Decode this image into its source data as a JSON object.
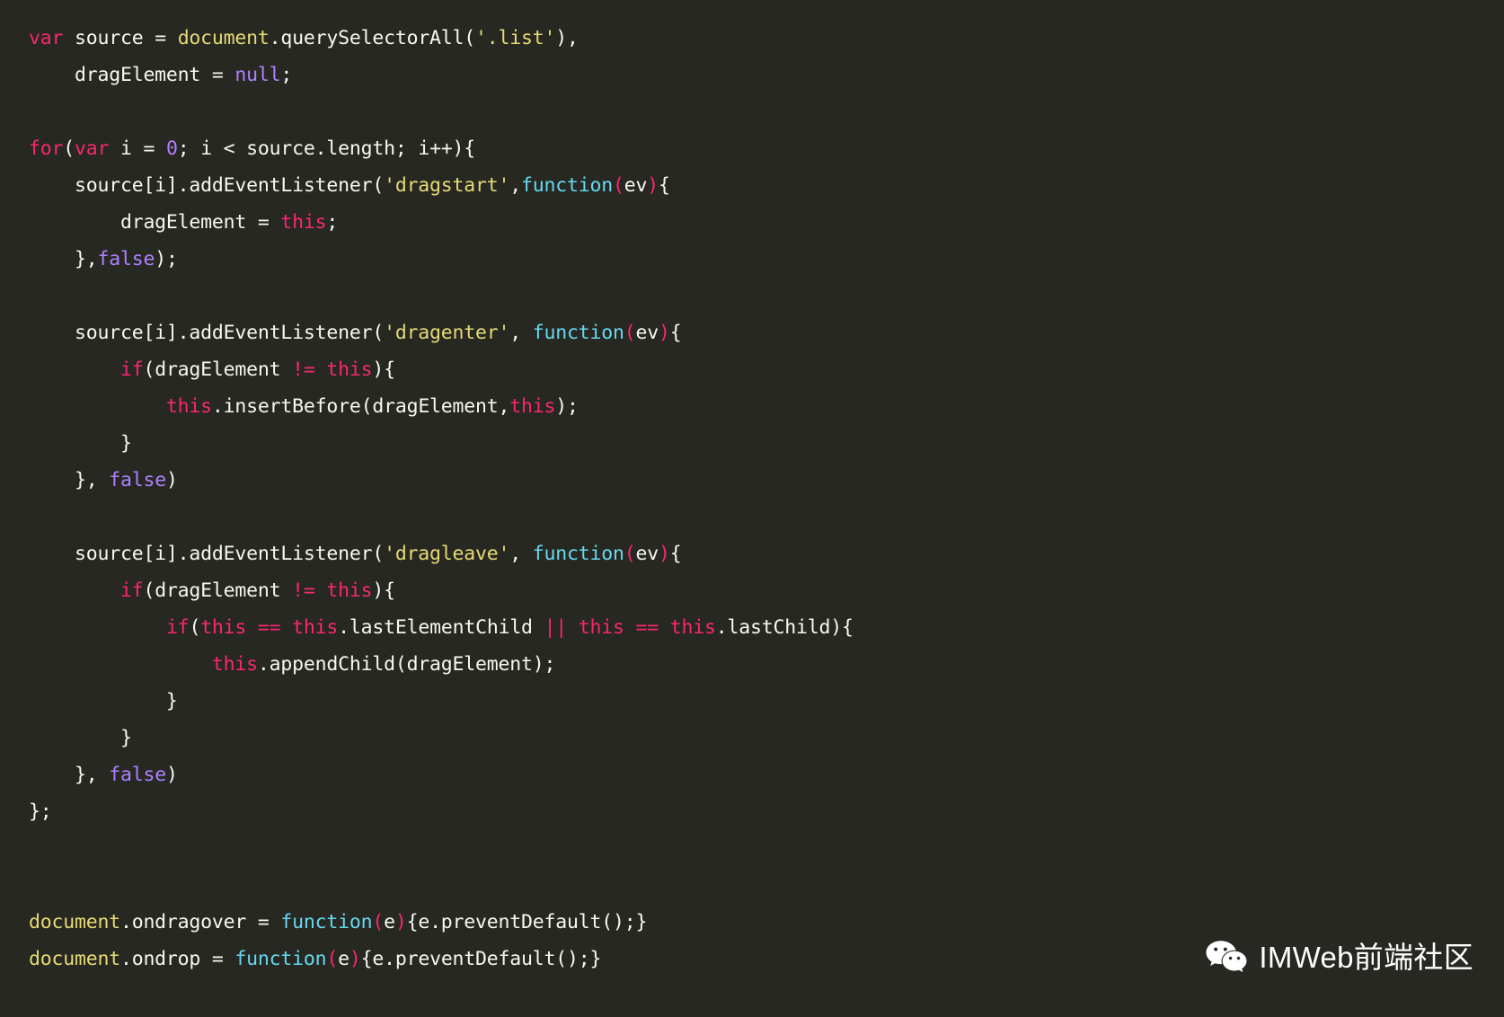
{
  "editor": {
    "theme_name": "monokai",
    "language": "javascript",
    "background_color": "#272822",
    "default_text_color": "#F8F8F2",
    "colors": {
      "keyword": "#F92672",
      "string": "#E6DB74",
      "identifier": "#E6DB74",
      "function_keyword": "#66D9EF",
      "literal": "#AE81FF",
      "punctuation": "#F92672",
      "plain": "#F8F8F2"
    },
    "lines": [
      {
        "id": "line-1",
        "tokens": [
          {
            "t": "var",
            "c": "kw"
          },
          {
            "t": " source ",
            "c": "plain"
          },
          {
            "t": "= ",
            "c": "plain"
          },
          {
            "t": "document",
            "c": "ident"
          },
          {
            "t": ".querySelectorAll(",
            "c": "plain"
          },
          {
            "t": "'.list'",
            "c": "str"
          },
          {
            "t": "),",
            "c": "plain"
          }
        ]
      },
      {
        "id": "line-2",
        "tokens": [
          {
            "t": "    dragElement = ",
            "c": "plain"
          },
          {
            "t": "null",
            "c": "lit"
          },
          {
            "t": ";",
            "c": "plain"
          }
        ]
      },
      {
        "id": "line-3",
        "tokens": [
          {
            "t": " ",
            "c": "plain"
          }
        ]
      },
      {
        "id": "line-4",
        "tokens": [
          {
            "t": "for",
            "c": "kw"
          },
          {
            "t": "(",
            "c": "plain"
          },
          {
            "t": "var",
            "c": "kw"
          },
          {
            "t": " i = ",
            "c": "plain"
          },
          {
            "t": "0",
            "c": "num"
          },
          {
            "t": "; i < source.length; i++){",
            "c": "plain"
          }
        ]
      },
      {
        "id": "line-5",
        "tokens": [
          {
            "t": "    source[i].addEventListener(",
            "c": "plain"
          },
          {
            "t": "'dragstart'",
            "c": "str"
          },
          {
            "t": ",",
            "c": "plain"
          },
          {
            "t": "function",
            "c": "fn"
          },
          {
            "t": "(",
            "c": "punct"
          },
          {
            "t": "ev",
            "c": "plain"
          },
          {
            "t": ")",
            "c": "punct"
          },
          {
            "t": "{",
            "c": "plain"
          }
        ]
      },
      {
        "id": "line-6",
        "tokens": [
          {
            "t": "        dragElement = ",
            "c": "plain"
          },
          {
            "t": "this",
            "c": "kw"
          },
          {
            "t": ";",
            "c": "plain"
          }
        ]
      },
      {
        "id": "line-7",
        "tokens": [
          {
            "t": "    },",
            "c": "plain"
          },
          {
            "t": "false",
            "c": "lit"
          },
          {
            "t": ");",
            "c": "plain"
          }
        ]
      },
      {
        "id": "line-8",
        "tokens": [
          {
            "t": " ",
            "c": "plain"
          }
        ]
      },
      {
        "id": "line-9",
        "tokens": [
          {
            "t": "    source[i].addEventListener(",
            "c": "plain"
          },
          {
            "t": "'dragenter'",
            "c": "str"
          },
          {
            "t": ", ",
            "c": "plain"
          },
          {
            "t": "function",
            "c": "fn"
          },
          {
            "t": "(",
            "c": "punct"
          },
          {
            "t": "ev",
            "c": "plain"
          },
          {
            "t": ")",
            "c": "punct"
          },
          {
            "t": "{",
            "c": "plain"
          }
        ]
      },
      {
        "id": "line-10",
        "tokens": [
          {
            "t": "        ",
            "c": "plain"
          },
          {
            "t": "if",
            "c": "kw"
          },
          {
            "t": "(dragElement ",
            "c": "plain"
          },
          {
            "t": "!=",
            "c": "punct"
          },
          {
            "t": " ",
            "c": "plain"
          },
          {
            "t": "this",
            "c": "kw"
          },
          {
            "t": "){",
            "c": "plain"
          }
        ]
      },
      {
        "id": "line-11",
        "tokens": [
          {
            "t": "            ",
            "c": "plain"
          },
          {
            "t": "this",
            "c": "kw"
          },
          {
            "t": ".insertBefore(dragElement,",
            "c": "plain"
          },
          {
            "t": "this",
            "c": "kw"
          },
          {
            "t": ");",
            "c": "plain"
          }
        ]
      },
      {
        "id": "line-12",
        "tokens": [
          {
            "t": "        }",
            "c": "plain"
          }
        ]
      },
      {
        "id": "line-13",
        "tokens": [
          {
            "t": "    }, ",
            "c": "plain"
          },
          {
            "t": "false",
            "c": "lit"
          },
          {
            "t": ")",
            "c": "plain"
          }
        ]
      },
      {
        "id": "line-14",
        "tokens": [
          {
            "t": " ",
            "c": "plain"
          }
        ]
      },
      {
        "id": "line-15",
        "tokens": [
          {
            "t": "    source[i].addEventListener(",
            "c": "plain"
          },
          {
            "t": "'dragleave'",
            "c": "str"
          },
          {
            "t": ", ",
            "c": "plain"
          },
          {
            "t": "function",
            "c": "fn"
          },
          {
            "t": "(",
            "c": "punct"
          },
          {
            "t": "ev",
            "c": "plain"
          },
          {
            "t": ")",
            "c": "punct"
          },
          {
            "t": "{",
            "c": "plain"
          }
        ]
      },
      {
        "id": "line-16",
        "tokens": [
          {
            "t": "        ",
            "c": "plain"
          },
          {
            "t": "if",
            "c": "kw"
          },
          {
            "t": "(dragElement ",
            "c": "plain"
          },
          {
            "t": "!=",
            "c": "punct"
          },
          {
            "t": " ",
            "c": "plain"
          },
          {
            "t": "this",
            "c": "kw"
          },
          {
            "t": "){",
            "c": "plain"
          }
        ]
      },
      {
        "id": "line-17",
        "tokens": [
          {
            "t": "            ",
            "c": "plain"
          },
          {
            "t": "if",
            "c": "kw"
          },
          {
            "t": "(",
            "c": "plain"
          },
          {
            "t": "this",
            "c": "kw"
          },
          {
            "t": " ",
            "c": "plain"
          },
          {
            "t": "==",
            "c": "punct"
          },
          {
            "t": " ",
            "c": "plain"
          },
          {
            "t": "this",
            "c": "kw"
          },
          {
            "t": ".lastElementChild ",
            "c": "plain"
          },
          {
            "t": "||",
            "c": "punct"
          },
          {
            "t": " ",
            "c": "plain"
          },
          {
            "t": "this",
            "c": "kw"
          },
          {
            "t": " ",
            "c": "plain"
          },
          {
            "t": "==",
            "c": "punct"
          },
          {
            "t": " ",
            "c": "plain"
          },
          {
            "t": "this",
            "c": "kw"
          },
          {
            "t": ".lastChild){",
            "c": "plain"
          }
        ]
      },
      {
        "id": "line-18",
        "tokens": [
          {
            "t": "                ",
            "c": "plain"
          },
          {
            "t": "this",
            "c": "kw"
          },
          {
            "t": ".appendChild(dragElement);",
            "c": "plain"
          }
        ]
      },
      {
        "id": "line-19",
        "tokens": [
          {
            "t": "            }",
            "c": "plain"
          }
        ]
      },
      {
        "id": "line-20",
        "tokens": [
          {
            "t": "        }",
            "c": "plain"
          }
        ]
      },
      {
        "id": "line-21",
        "tokens": [
          {
            "t": "    }, ",
            "c": "plain"
          },
          {
            "t": "false",
            "c": "lit"
          },
          {
            "t": ")",
            "c": "plain"
          }
        ]
      },
      {
        "id": "line-22",
        "tokens": [
          {
            "t": "};",
            "c": "plain"
          }
        ]
      },
      {
        "id": "line-23",
        "tokens": [
          {
            "t": " ",
            "c": "plain"
          }
        ]
      },
      {
        "id": "line-24",
        "tokens": [
          {
            "t": " ",
            "c": "plain"
          }
        ]
      },
      {
        "id": "line-25",
        "tokens": [
          {
            "t": "document",
            "c": "ident"
          },
          {
            "t": ".ondragover = ",
            "c": "plain"
          },
          {
            "t": "function",
            "c": "fn"
          },
          {
            "t": "(",
            "c": "punct"
          },
          {
            "t": "e",
            "c": "plain"
          },
          {
            "t": ")",
            "c": "punct"
          },
          {
            "t": "{e.preventDefault();}",
            "c": "plain"
          }
        ]
      },
      {
        "id": "line-26",
        "tokens": [
          {
            "t": "document",
            "c": "ident"
          },
          {
            "t": ".ondrop = ",
            "c": "plain"
          },
          {
            "t": "function",
            "c": "fn"
          },
          {
            "t": "(",
            "c": "punct"
          },
          {
            "t": "e",
            "c": "plain"
          },
          {
            "t": ")",
            "c": "punct"
          },
          {
            "t": "{e.preventDefault();}",
            "c": "plain"
          }
        ]
      }
    ]
  },
  "watermark": {
    "icon": "wechat-icon",
    "label": "IMWeb前端社区",
    "text_color": "#FFFFFF"
  }
}
